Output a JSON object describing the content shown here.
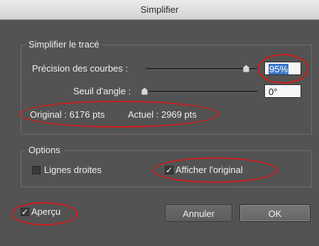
{
  "window": {
    "title": "Simplifier"
  },
  "simplify_group": {
    "title": "Simplifier le tracé",
    "curve_precision": {
      "label": "Précision des courbes :",
      "value": "95%",
      "slider_level": 0.95
    },
    "angle_threshold": {
      "label": "Seuil d'angle :",
      "value": "0°",
      "slider_level": 0.0
    },
    "stats": {
      "original": "Original : 6176 pts",
      "current": "Actuel : 2969 pts"
    }
  },
  "options_group": {
    "title": "Options",
    "straight_lines": {
      "label": "Lignes droites",
      "checked": false
    },
    "show_original": {
      "label": "Afficher l'original",
      "checked": true
    }
  },
  "preview": {
    "label": "Aperçu",
    "checked": true
  },
  "buttons": {
    "cancel": "Annuler",
    "ok": "OK"
  },
  "colors": {
    "annotation": "#cc1d1d",
    "selection": "#3d78c9"
  }
}
